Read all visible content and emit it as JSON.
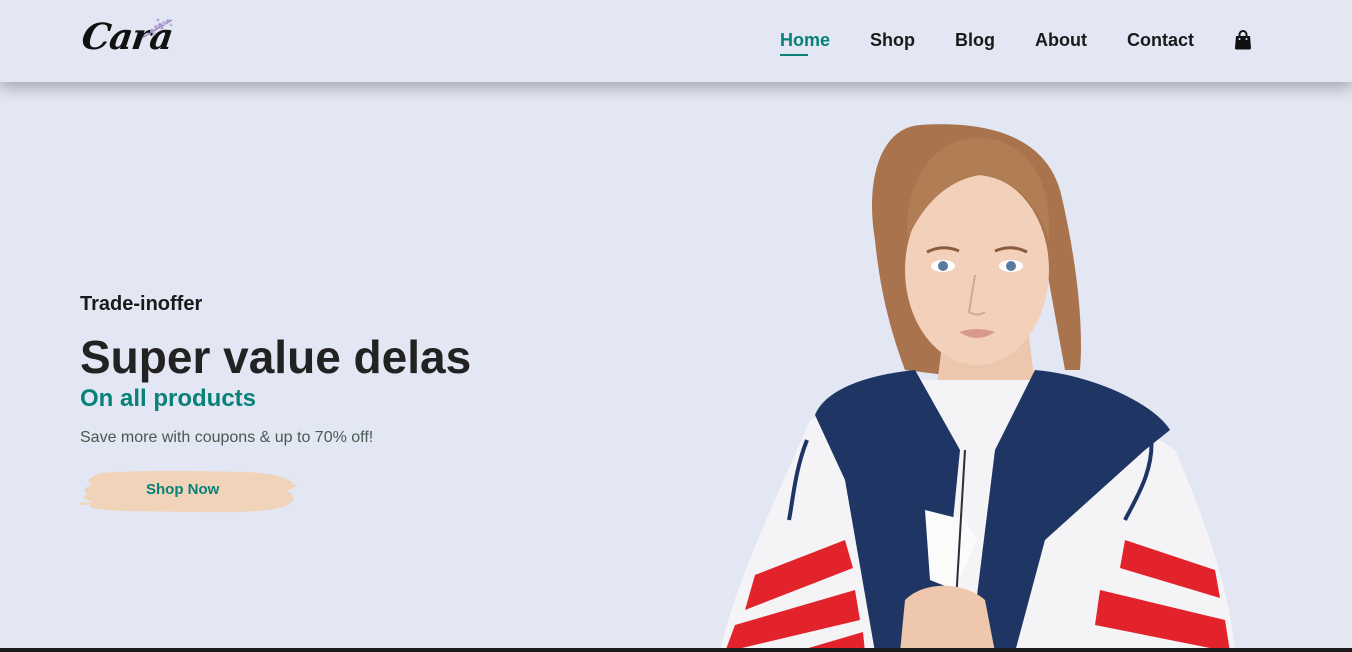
{
  "brand": {
    "logo_text": "Cara",
    "logo_icon": "lavender-sprig-icon"
  },
  "nav": {
    "items": [
      {
        "label": "Home",
        "active": true
      },
      {
        "label": "Shop",
        "active": false
      },
      {
        "label": "Blog",
        "active": false
      },
      {
        "label": "About",
        "active": false
      },
      {
        "label": "Contact",
        "active": false
      }
    ],
    "cart_icon": "shopping-bag-icon"
  },
  "hero": {
    "kicker": "Trade-inoffer",
    "title": "Super value delas",
    "subtitle": "On all products",
    "description": "Save more with coupons & up to 70% off!",
    "cta_label": "Shop Now",
    "image_icon": "model-photo"
  },
  "colors": {
    "background": "#e3e6f3",
    "accent": "#088178",
    "button_bg": "#f0d3b8",
    "text_dark": "#1a1a1a"
  }
}
